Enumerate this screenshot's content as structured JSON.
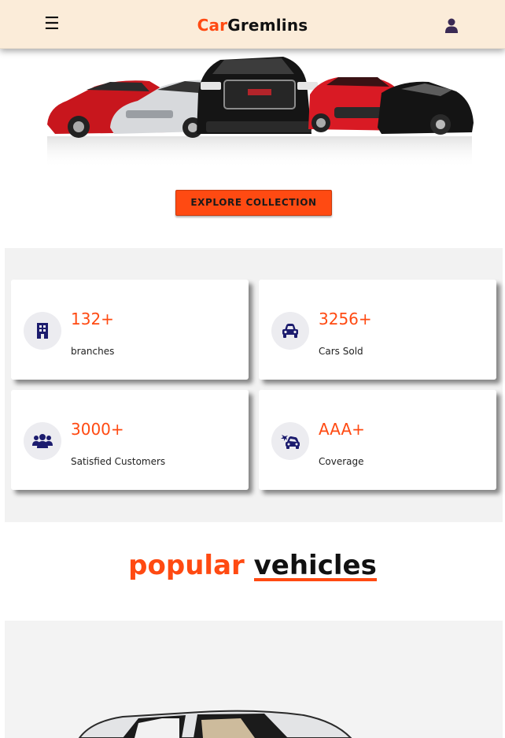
{
  "header": {
    "menu_glyph": "☰",
    "brand_part1": "Car",
    "brand_part2": "Gremlins",
    "user_icon": "user-icon"
  },
  "hero": {
    "image_desc": "cars-lineup-image",
    "cta_label": "EXPLORE COLLECTION"
  },
  "stats": [
    {
      "value": "132+",
      "label": "branches",
      "icon": "building-icon"
    },
    {
      "value": "3256+",
      "label": "Cars Sold",
      "icon": "car-icon"
    },
    {
      "value": "3000+",
      "label": "Satisfied Customers",
      "icon": "users-icon"
    },
    {
      "value": "AAA+",
      "label": "Coverage",
      "icon": "car-crash-icon"
    }
  ],
  "popular": {
    "title_part1": "popular",
    "title_part2": "vehicles"
  },
  "colors": {
    "accent": "#ff4a12",
    "header_bg": "#fbecd9",
    "icon_navy": "#1c1c6e"
  }
}
